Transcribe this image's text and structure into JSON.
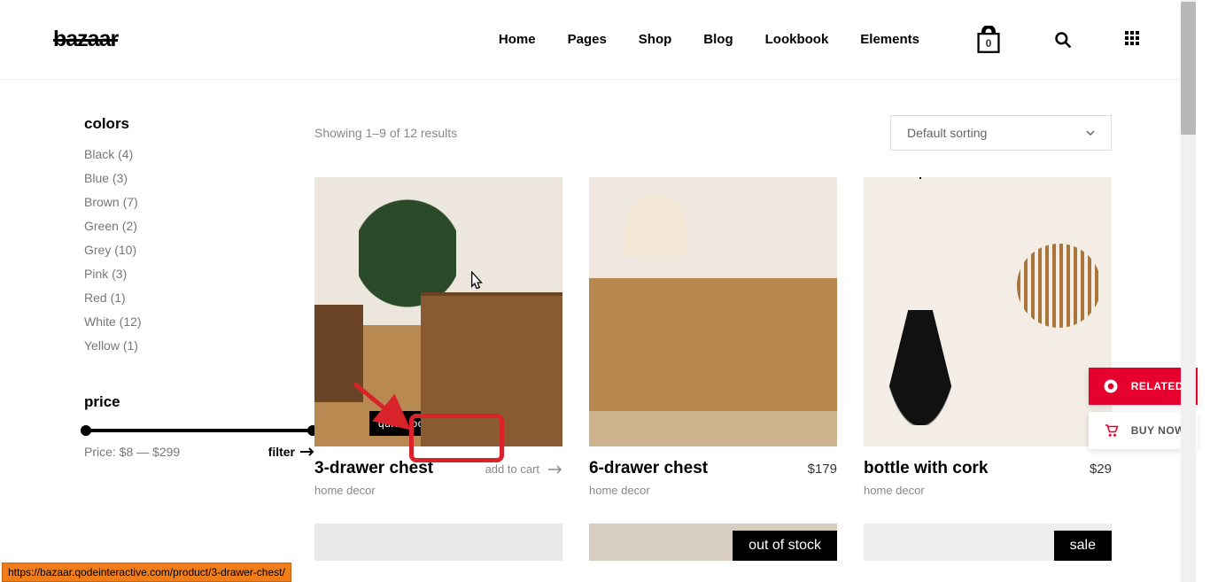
{
  "logo": "bazaar",
  "nav": [
    "Home",
    "Pages",
    "Shop",
    "Blog",
    "Lookbook",
    "Elements"
  ],
  "cart_count": "0",
  "sidebar": {
    "colors_title": "colors",
    "colors": [
      "Black (4)",
      "Blue (3)",
      "Brown (7)",
      "Green (2)",
      "Grey (10)",
      "Pink (3)",
      "Red (1)",
      "White (12)",
      "Yellow (1)"
    ],
    "price_title": "price",
    "price_text": "Price: $8 — $299",
    "filter_label": "filter"
  },
  "results_text": "Showing 1–9 of 12 results",
  "sort_label": "Default sorting",
  "products": [
    {
      "name": "3-drawer chest",
      "price": "",
      "addcart": "add to cart",
      "cat": "home decor",
      "quicklook": "quick look"
    },
    {
      "name": "6-drawer chest",
      "price": "$179",
      "cat": "home decor"
    },
    {
      "name": "bottle with cork",
      "price": "$29",
      "cat": "home decor"
    }
  ],
  "badges": {
    "oos": "out of stock",
    "sale": "sale"
  },
  "side": {
    "related": "RELATED",
    "buy": "BUY NOW"
  },
  "status_url": "https://bazaar.qodeinteractive.com/product/3-drawer-chest/"
}
